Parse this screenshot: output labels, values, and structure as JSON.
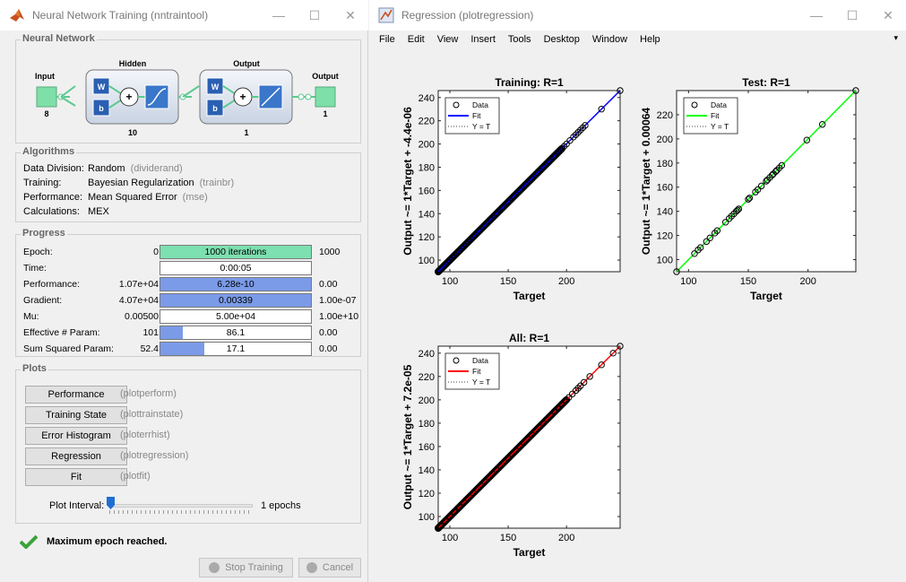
{
  "nntraintool": {
    "title": "Neural Network Training (nntraintool)",
    "titlebar_buttons": [
      "—",
      "☐",
      "✕"
    ],
    "network": {
      "heading": "Neural Network",
      "input_label": "Input",
      "input_size": "8",
      "hidden_label": "Hidden",
      "hidden_size": "10",
      "output_layer_label": "Output",
      "output_layer_size": "1",
      "output_label": "Output",
      "output_size": "1",
      "weight_label": "W",
      "bias_label": "b",
      "sum_symbol": "+"
    },
    "algorithms": {
      "heading": "Algorithms",
      "rows": [
        {
          "key": "Data Division:",
          "value": "Random",
          "paren": "(dividerand)"
        },
        {
          "key": "Training:",
          "value": "Bayesian Regularization",
          "paren": "(trainbr)"
        },
        {
          "key": "Performance:",
          "value": "Mean Squared Error",
          "paren": "(mse)"
        },
        {
          "key": "Calculations:",
          "value": "MEX",
          "paren": ""
        }
      ]
    },
    "progress": {
      "heading": "Progress",
      "rows": [
        {
          "label": "Epoch:",
          "start": "0",
          "bar_text": "1000 iterations",
          "end": "1000",
          "fill": 1.0,
          "fill_color": "#7de0b0"
        },
        {
          "label": "Time:",
          "start": "",
          "bar_text": "0:00:05",
          "end": "",
          "fill": 0.0,
          "fill_color": "#7b9be8"
        },
        {
          "label": "Performance:",
          "start": "1.07e+04",
          "bar_text": "6.28e-10",
          "end": "0.00",
          "fill": 1.0,
          "fill_color": "#7b9be8"
        },
        {
          "label": "Gradient:",
          "start": "4.07e+04",
          "bar_text": "0.00339",
          "end": "1.00e-07",
          "fill": 1.0,
          "fill_color": "#7b9be8"
        },
        {
          "label": "Mu:",
          "start": "0.00500",
          "bar_text": "5.00e+04",
          "end": "1.00e+10",
          "fill": 0.0,
          "fill_color": "#7b9be8"
        },
        {
          "label": "Effective # Param:",
          "start": "101",
          "bar_text": "86.1",
          "end": "0.00",
          "fill": 0.15,
          "fill_color": "#7b9be8"
        },
        {
          "label": "Sum Squared Param:",
          "start": "52.4",
          "bar_text": "17.1",
          "end": "0.00",
          "fill": 0.29,
          "fill_color": "#7b9be8"
        }
      ]
    },
    "plots": {
      "heading": "Plots",
      "buttons": [
        {
          "label": "Performance",
          "paren": "(plotperform)"
        },
        {
          "label": "Training State",
          "paren": "(plottrainstate)"
        },
        {
          "label": "Error Histogram",
          "paren": "(ploterrhist)"
        },
        {
          "label": "Regression",
          "paren": "(plotregression)"
        },
        {
          "label": "Fit",
          "paren": "(plotfit)"
        }
      ],
      "interval_label": "Plot Interval:",
      "interval_value": "1 epochs",
      "interval_level": 0.0
    },
    "status": "Maximum epoch reached.",
    "stop_button": "Stop Training",
    "cancel_button": "Cancel"
  },
  "plotregression": {
    "title": "Regression (plotregression)",
    "titlebar_buttons": [
      "—",
      "☐",
      "✕"
    ],
    "menu": [
      "File",
      "Edit",
      "View",
      "Insert",
      "Tools",
      "Desktop",
      "Window",
      "Help"
    ],
    "menu_mnemonics": [
      0,
      0,
      0,
      0,
      0,
      0,
      0,
      0
    ],
    "menu_arrow": "▾"
  },
  "chart_data": [
    {
      "type": "scatter",
      "title": "Training: R=1",
      "xlabel": "Target",
      "ylabel": "Output ~= 1*Target + -4.4e-06",
      "xlim": [
        90,
        246
      ],
      "ylim": [
        90,
        246
      ],
      "xticks": [
        100,
        150,
        200
      ],
      "yticks": [
        100,
        120,
        140,
        160,
        180,
        200,
        220,
        240
      ],
      "fit_color": "#0000ff",
      "marker_color": "#000000",
      "legend": [
        "Data",
        "Fit",
        "Y = T"
      ],
      "legend_position": "top-left",
      "dense_ranges": [
        [
          90,
          196
        ]
      ],
      "points": [
        96,
        98,
        100,
        102,
        104,
        106,
        108,
        110,
        112,
        114,
        116,
        118,
        120,
        125,
        130,
        135,
        140,
        145,
        150,
        155,
        160,
        165,
        170,
        175,
        180,
        185,
        190,
        193,
        195,
        198,
        200,
        203,
        206,
        208,
        210,
        212,
        214,
        216,
        230,
        246
      ]
    },
    {
      "type": "scatter",
      "title": "Test: R=1",
      "xlabel": "Target",
      "ylabel": "Output ~= 1*Target + 0.00064",
      "xlim": [
        90,
        240
      ],
      "ylim": [
        90,
        240
      ],
      "xticks": [
        100,
        150,
        200
      ],
      "yticks": [
        100,
        120,
        140,
        160,
        180,
        200,
        220
      ],
      "fit_color": "#00ff00",
      "marker_color": "#000000",
      "legend": [
        "Data",
        "Fit",
        "Y = T"
      ],
      "legend_position": "top-left",
      "dense_ranges": [],
      "points": [
        90,
        105,
        108,
        110,
        115,
        118,
        122,
        124,
        131,
        134,
        136,
        138,
        140,
        141,
        142,
        150,
        151,
        156,
        158,
        161,
        165,
        166,
        168,
        170,
        171,
        173,
        174,
        176,
        178,
        199,
        212,
        240
      ]
    },
    {
      "type": "scatter",
      "title": "All: R=1",
      "xlabel": "Target",
      "ylabel": "Output ~= 1*Target + 7.2e-05",
      "xlim": [
        90,
        246
      ],
      "ylim": [
        90,
        246
      ],
      "xticks": [
        100,
        150,
        200
      ],
      "yticks": [
        100,
        120,
        140,
        160,
        180,
        200,
        220,
        240
      ],
      "fit_color": "#ff0000",
      "marker_color": "#000000",
      "legend": [
        "Data",
        "Fit",
        "Y = T"
      ],
      "legend_position": "top-left",
      "dense_ranges": [
        [
          90,
          200
        ]
      ],
      "points": [
        92,
        96,
        100,
        104,
        108,
        112,
        120,
        130,
        140,
        150,
        160,
        170,
        180,
        190,
        193,
        196,
        199,
        202,
        205,
        208,
        210,
        212,
        215,
        220,
        230,
        240,
        246
      ]
    }
  ]
}
